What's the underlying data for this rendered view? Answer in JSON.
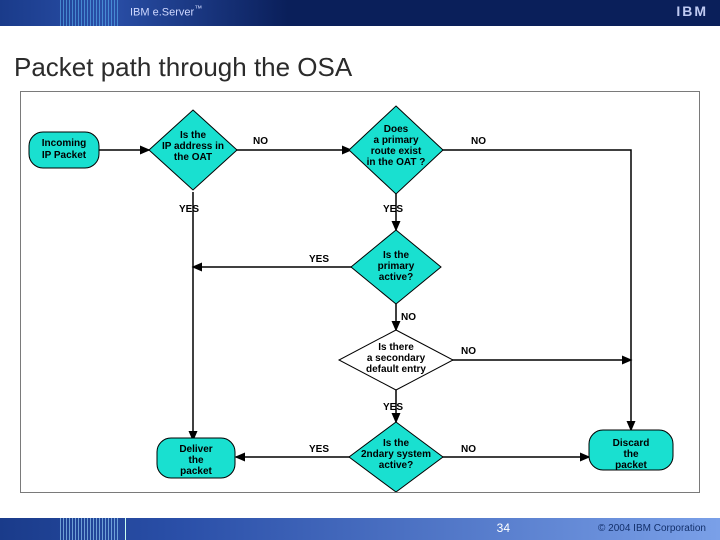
{
  "header": {
    "brand_prefix": "IBM e.",
    "brand_main": "Server",
    "brand_tm": "™",
    "logo": "IBM"
  },
  "title": "Packet path through the OSA",
  "diagram": {
    "nodes": {
      "incoming": "Incoming IP Packet",
      "ip_in_oat": "Is the IP address in the OAT",
      "primary_rt": "Does a primary route exist in the OAT ?",
      "prim_active": "Is the primary active?",
      "sec_entry": "Is there a secondary default entry",
      "sec_active": "Is the 2ndary system active?",
      "deliver": "Deliver the packet",
      "discard": "Discard the packet"
    },
    "labels": {
      "yes": "YES",
      "no": "NO"
    }
  },
  "footer": {
    "page": "34",
    "copyright": "© 2004 IBM Corporation"
  }
}
